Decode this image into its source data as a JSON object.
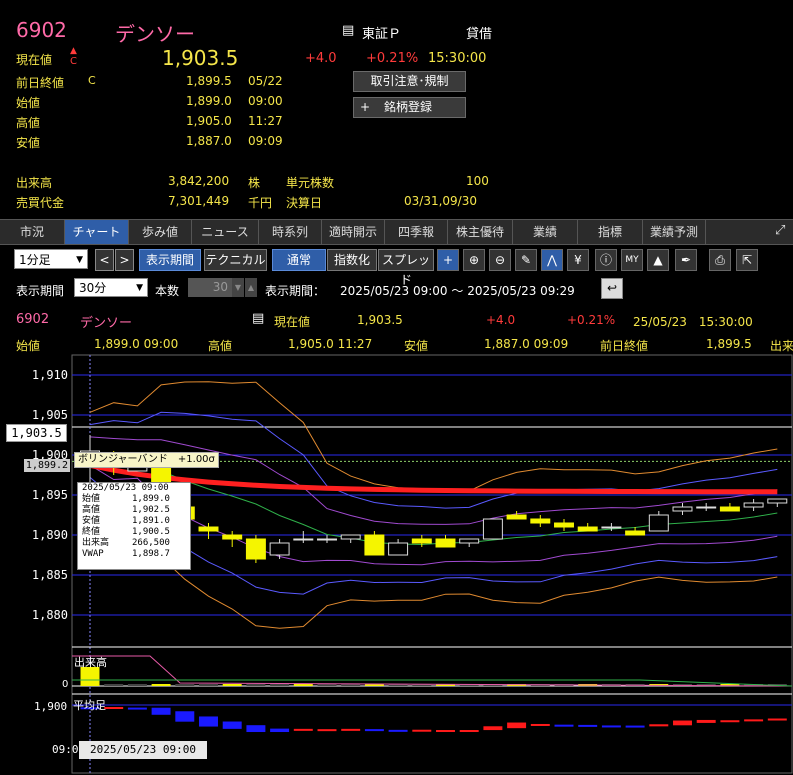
{
  "stock": {
    "code": "6902",
    "name": "デンソー",
    "market_icon": "document-icon",
    "market": "東証Ｐ",
    "margin": "貸借",
    "current_label": "現在値",
    "arrow": "▲",
    "c_mark": "C",
    "current_price": "1,903.5",
    "change": "+4.0",
    "change_pct": "+0.21%",
    "time": "15:30:00",
    "rows": [
      {
        "label": "前日終値",
        "mark": "C",
        "value": "1,899.5",
        "time": "05/22"
      },
      {
        "label": "始値",
        "value": "1,899.0",
        "time": "09:00"
      },
      {
        "label": "高値",
        "value": "1,905.0",
        "time": "11:27"
      },
      {
        "label": "安値",
        "value": "1,887.0",
        "time": "09:09"
      }
    ],
    "volume_label": "出来高",
    "volume": "3,842,200",
    "volume_unit": "株",
    "trading_value_label": "売買代金",
    "trading_value": "7,301,449",
    "trading_value_unit": "千円",
    "unit_shares_label": "単元株数",
    "unit_shares": "100",
    "fiscal_label": "決算日",
    "fiscal": "03/31,09/30",
    "btn_caution": "取引注意･規制",
    "btn_register_plus": "+",
    "btn_register": "銘柄登録"
  },
  "tabs": [
    "市況",
    "チャート",
    "歩み値",
    "ニュース",
    "時系列",
    "適時開示",
    "四季報",
    "株主優待",
    "業績",
    "指標",
    "業績予測"
  ],
  "active_tab": "チャート",
  "toolbar": {
    "interval": "1分足",
    "prev": "<",
    "next": ">",
    "period_btn": "表示期間",
    "technical_btn": "テクニカル",
    "normal_btn": "通常",
    "index_btn": "指数化",
    "spread_btn": "スプレッド",
    "icons": [
      "crosshair-icon",
      "zoom-in-icon",
      "zoom-out-icon",
      "pencil-icon",
      "trend-icon",
      "yen-icon",
      "info-icon",
      "my-icon",
      "area-chart-icon",
      "wrench-icon",
      "print-icon",
      "export-icon"
    ]
  },
  "period_row": {
    "label": "表示期間",
    "value": "30分",
    "count_label": "本数",
    "count": "30",
    "range_label": "表示期間：",
    "range": "2025/05/23 09:00 ～ 2025/05/23 09:29"
  },
  "quote_bar": {
    "code": "6902",
    "name": "デンソー",
    "current_label": "現在値",
    "current": "1,903.5",
    "change": "+4.0",
    "change_pct": "+0.21%",
    "datetime": "25/05/23　15:30:00",
    "open_label": "始値",
    "open": "1,899.0 09:00",
    "high_label": "高値",
    "high": "1,905.0 11:27",
    "low_label": "安値",
    "low": "1,887.0 09:09",
    "prev_label": "前日終値",
    "prev": "1,899.5",
    "extra": "出来"
  },
  "chart_data": {
    "type": "candlestick",
    "y_ticks": [
      "1,910",
      "1,905",
      "1,900",
      "1,895",
      "1,890",
      "1,885",
      "1,880"
    ],
    "ylim": [
      1877.5,
      1911.5
    ],
    "current_tag": "1,903.5",
    "prev_tag": "1,899.2",
    "legend": "ボリンジャーバンド　+1.00σ",
    "candles": [
      {
        "o": 1899.0,
        "h": 1902.5,
        "l": 1891.0,
        "c": 1900.5
      },
      {
        "o": 1900.0,
        "h": 1900.5,
        "l": 1897.5,
        "c": 1898.5
      },
      {
        "o": 1898.0,
        "h": 1899.5,
        "l": 1898.0,
        "c": 1899.5
      },
      {
        "o": 1899.0,
        "h": 1899.5,
        "l": 1891.0,
        "c": 1893.5
      },
      {
        "o": 1893.5,
        "h": 1894.0,
        "l": 1891.5,
        "c": 1892.0
      },
      {
        "o": 1891.0,
        "h": 1891.5,
        "l": 1889.5,
        "c": 1890.5
      },
      {
        "o": 1890.0,
        "h": 1890.5,
        "l": 1888.5,
        "c": 1889.5
      },
      {
        "o": 1889.5,
        "h": 1890.0,
        "l": 1886.5,
        "c": 1887.0
      },
      {
        "o": 1887.5,
        "h": 1889.5,
        "l": 1887.0,
        "c": 1889.0
      },
      {
        "o": 1889.5,
        "h": 1890.5,
        "l": 1889.0,
        "c": 1889.5
      },
      {
        "o": 1889.5,
        "h": 1890.0,
        "l": 1889.0,
        "c": 1889.5
      },
      {
        "o": 1889.5,
        "h": 1890.0,
        "l": 1889.0,
        "c": 1890.0
      },
      {
        "o": 1890.0,
        "h": 1890.5,
        "l": 1887.5,
        "c": 1887.5
      },
      {
        "o": 1887.5,
        "h": 1889.5,
        "l": 1887.5,
        "c": 1889.0
      },
      {
        "o": 1889.5,
        "h": 1890.0,
        "l": 1888.5,
        "c": 1889.0
      },
      {
        "o": 1889.5,
        "h": 1890.0,
        "l": 1888.5,
        "c": 1888.5
      },
      {
        "o": 1889.0,
        "h": 1889.5,
        "l": 1888.5,
        "c": 1889.5
      },
      {
        "o": 1889.5,
        "h": 1892.0,
        "l": 1889.5,
        "c": 1892.0
      },
      {
        "o": 1892.5,
        "h": 1893.0,
        "l": 1892.0,
        "c": 1892.0
      },
      {
        "o": 1892.0,
        "h": 1892.5,
        "l": 1891.0,
        "c": 1891.5
      },
      {
        "o": 1891.5,
        "h": 1892.0,
        "l": 1890.5,
        "c": 1891.0
      },
      {
        "o": 1891.0,
        "h": 1891.5,
        "l": 1890.5,
        "c": 1890.5
      },
      {
        "o": 1891.0,
        "h": 1891.5,
        "l": 1890.5,
        "c": 1891.0
      },
      {
        "o": 1890.5,
        "h": 1891.0,
        "l": 1890.0,
        "c": 1890.0
      },
      {
        "o": 1890.5,
        "h": 1893.0,
        "l": 1890.5,
        "c": 1892.5
      },
      {
        "o": 1893.0,
        "h": 1894.0,
        "l": 1892.5,
        "c": 1893.5
      },
      {
        "o": 1893.5,
        "h": 1894.0,
        "l": 1893.0,
        "c": 1893.5
      },
      {
        "o": 1893.5,
        "h": 1894.0,
        "l": 1893.0,
        "c": 1893.0
      },
      {
        "o": 1893.5,
        "h": 1894.5,
        "l": 1893.0,
        "c": 1894.0
      },
      {
        "o": 1894.0,
        "h": 1894.5,
        "l": 1893.5,
        "c": 1894.5
      }
    ],
    "tooltip": [
      {
        "k": "",
        "v": "2025/05/23 09:00"
      },
      {
        "k": "始値",
        "v": "1,899.0"
      },
      {
        "k": "高値",
        "v": "1,902.5"
      },
      {
        "k": "安値",
        "v": "1,891.0"
      },
      {
        "k": "終値",
        "v": "1,900.5"
      },
      {
        "k": "出来高",
        "v": "266,500"
      },
      {
        "k": "VWAP",
        "v": "1,898.7"
      }
    ],
    "volume_label": "出来高",
    "volume_zero": "0",
    "avg_label": "平均足",
    "avg_tick": "1,900",
    "x_time": "09:0",
    "cursor_date": "2025/05/23 09:00",
    "colors": {
      "up": "#f5f500",
      "down": "#000",
      "bb_outer": "#e08a30",
      "bb_mid": "#5a5aff",
      "bb_inner": "#a04ad0",
      "ma": "#2fb04a",
      "vwap": "#ff2020",
      "grid": "#2a2aee"
    }
  }
}
